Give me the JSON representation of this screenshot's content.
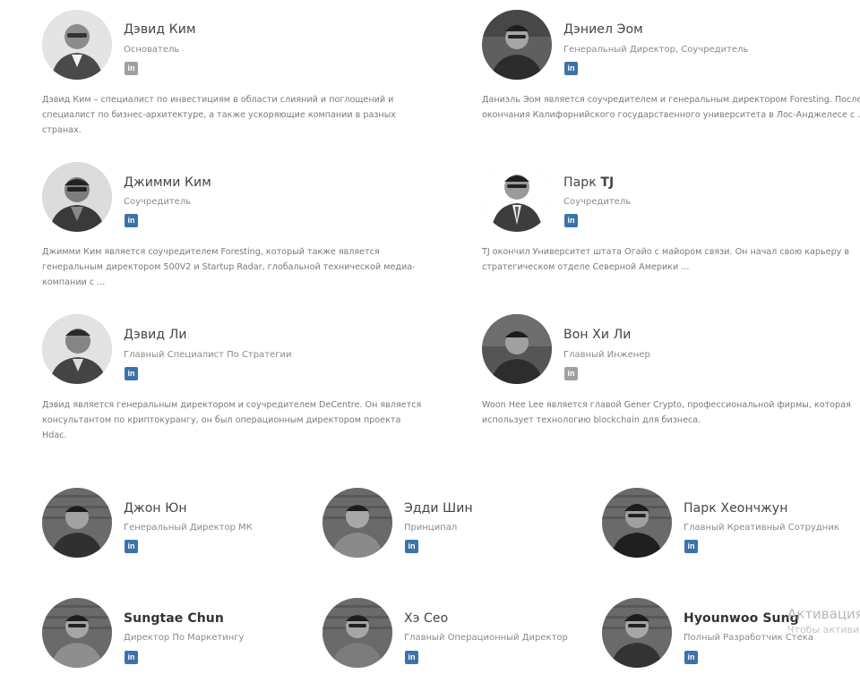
{
  "team": [
    {
      "name": "Дэвид Ким",
      "role": "Основатель",
      "desc": "Дэвид Ким – специалист по инвестициям в области слияний и поглощений и специалист по бизнес-архитектуре, а также ускоряющие компании в разных странах.",
      "linkedin": "in"
    },
    {
      "name": "Дэниел Эом",
      "role": "Генеральный Директор, Соучредитель",
      "desc": "Даниэль Эом является соучредителем и генеральным директором Foresting. После окончания Калифорнийского государственного университета в Лос-Анджелесе с ...",
      "linkedin": "in"
    },
    {
      "name": "Джимми Ким",
      "role": "Соучредитель",
      "desc": "Джимми Ким является соучредителем Foresting, который также является генеральным директором 500V2 и Startup Radar, глобальной технической медиа-компании с ...",
      "linkedin": "in"
    },
    {
      "name_prefix": "Парк ",
      "name_bold": "TJ",
      "role": "Соучредитель",
      "desc": "TJ окончил Университет штата Огайо с майором связи. Он начал свою карьеру в стратегическом отделе Северной Америки ...",
      "linkedin": "in"
    },
    {
      "name": "Дэвид Ли",
      "role": "Главный Специалист По Стратегии",
      "desc": "Дэвид является генеральным директором и соучредителем DeCentre. Он является консультантом по криптокурангу, он был операционным директором проекта Hdac.",
      "linkedin": "in"
    },
    {
      "name": "Вон Хи Ли",
      "role": "Главный Инженер",
      "desc": "Woon Hee Lee является главой Gener Crypto, профессиональной фирмы, которая использует технологию blockchain для бизнеса.",
      "linkedin": "in"
    },
    {
      "name": "Джон Юн",
      "role": "Генеральный Директор МК",
      "linkedin": "in"
    },
    {
      "name": "Эдди Шин",
      "role": "Принципал",
      "linkedin": "in"
    },
    {
      "name": "Парк Хеончжун",
      "role": "Главный Креативный Сотрудник",
      "linkedin": "in"
    },
    {
      "name": "Sungtae Chun",
      "role": "Директор По Маркетингу",
      "linkedin": "in"
    },
    {
      "name": "Хэ Сео",
      "role": "Главный Операционный Директор",
      "linkedin": "in"
    },
    {
      "name": "Hyounwoo Sung",
      "role": "Полный Разработчик Стека",
      "linkedin": "in"
    }
  ],
  "watermark": {
    "line1": "Активация",
    "line2": "Чтобы активи"
  },
  "colors": {
    "linkedin": "#3b73a8",
    "linkedin_grey": "#a0a0a0"
  }
}
